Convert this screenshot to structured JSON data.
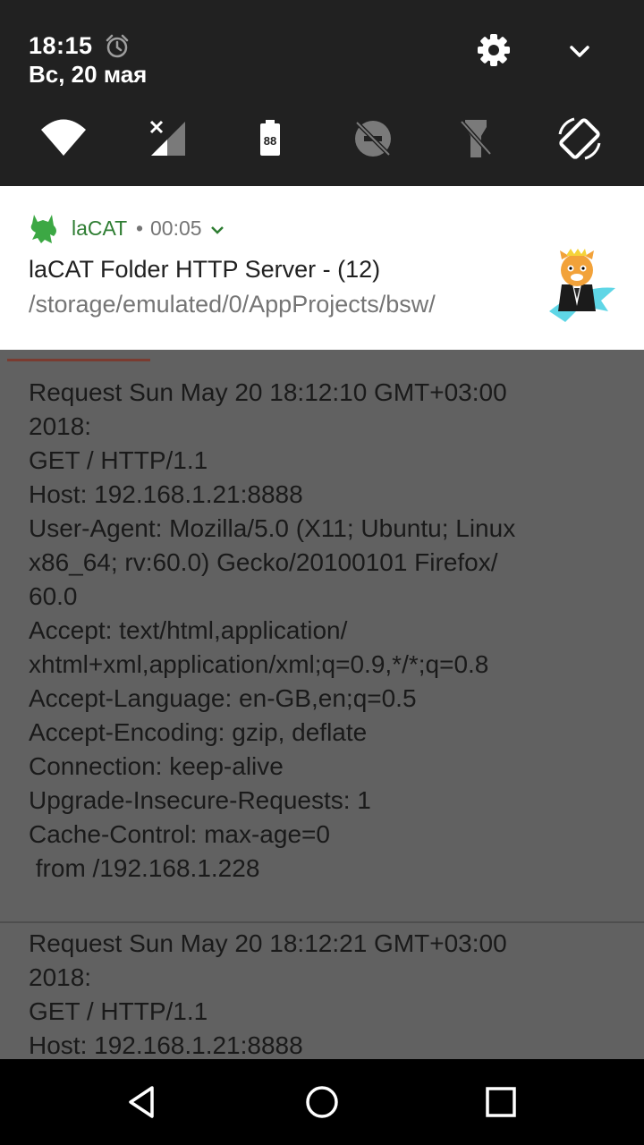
{
  "status": {
    "time": "18:15",
    "date": "Вс, 20 мая"
  },
  "icons": {
    "alarm": "alarm-clock-icon",
    "settings": "gear-icon",
    "collapse": "chevron-down-icon",
    "tiles": [
      "wifi-icon",
      "cellular-no-signal-icon",
      "battery-icon",
      "do-not-disturb-off-icon",
      "flashlight-off-icon",
      "auto-rotate-icon"
    ]
  },
  "quick_tiles": {
    "battery_level": "88"
  },
  "notification": {
    "app_name": "laCAT",
    "separator": "•",
    "time": "00:05",
    "title": "laCAT Folder HTTP Server - (12)",
    "text": "/storage/emulated/0/AppProjects/bsw/",
    "accent_color": "#2e7d32"
  },
  "log": {
    "entries": [
      "Request Sun May 20 18:12:10 GMT+03:00\n2018:\nGET / HTTP/1.1\nHost: 192.168.1.21:8888\nUser-Agent: Mozilla/5.0 (X11; Ubuntu; Linux\nx86_64; rv:60.0) Gecko/20100101 Firefox/\n60.0\nAccept: text/html,application/\nxhtml+xml,application/xml;q=0.9,*/*;q=0.8\nAccept-Language: en-GB,en;q=0.5\nAccept-Encoding: gzip, deflate\nConnection: keep-alive\nUpgrade-Insecure-Requests: 1\nCache-Control: max-age=0\n from /192.168.1.228",
      "Request Sun May 20 18:12:21 GMT+03:00\n2018:\nGET / HTTP/1.1\nHost: 192.168.1.21:8888"
    ]
  },
  "navbar": {
    "buttons": [
      "back-icon",
      "home-icon",
      "recents-icon"
    ]
  }
}
